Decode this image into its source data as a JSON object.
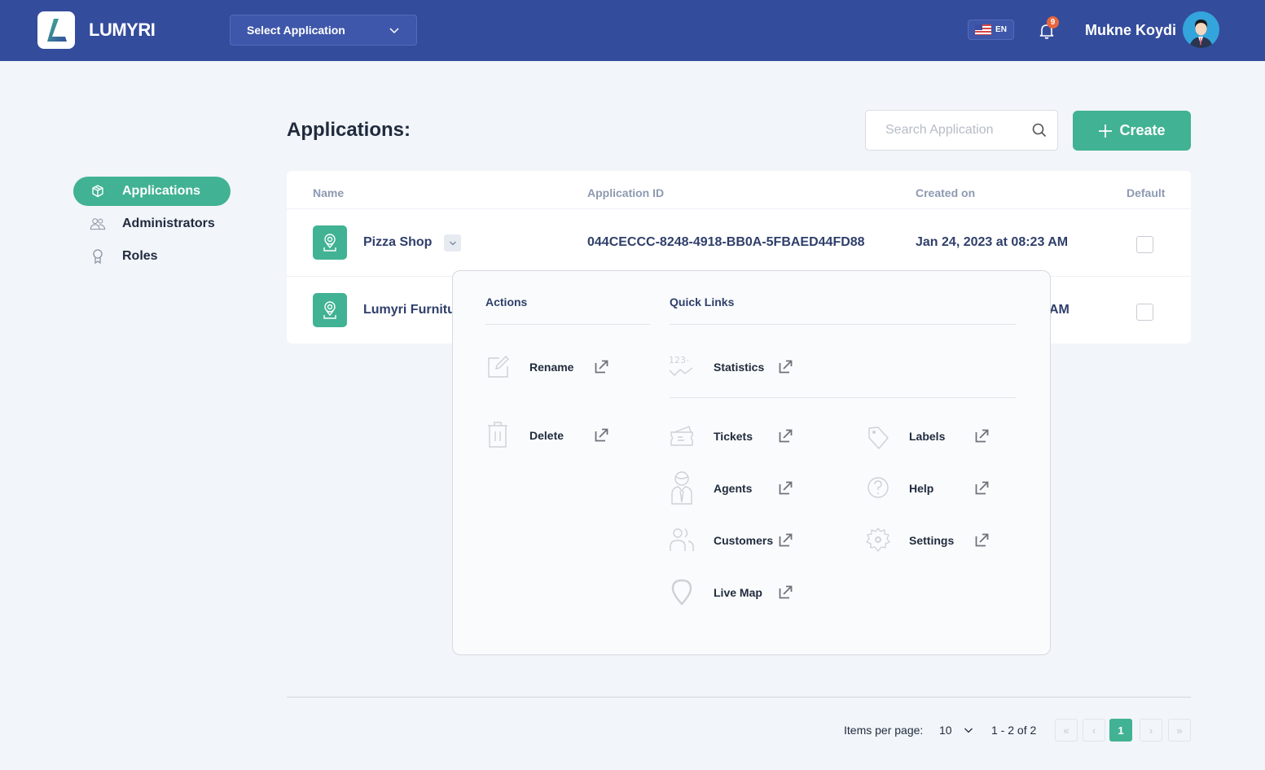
{
  "header": {
    "brand": "LUMYRI",
    "app_select_label": "Select Application",
    "language": "EN",
    "notification_count": "9",
    "user_name": "Mukne Koydi"
  },
  "sidebar": {
    "items": [
      {
        "label": "Applications",
        "icon": "cube-icon",
        "active": true
      },
      {
        "label": "Administrators",
        "icon": "users-icon",
        "active": false
      },
      {
        "label": "Roles",
        "icon": "award-icon",
        "active": false
      }
    ]
  },
  "main": {
    "title": "Applications:",
    "search_placeholder": "Search Application",
    "create_label": "Create"
  },
  "table": {
    "columns": [
      "Name",
      "Application ID",
      "Created on",
      "Default"
    ],
    "rows": [
      {
        "name": "Pizza Shop",
        "id": "044CECCC-8248-4918-BB0A-5FBAED44FD88",
        "created": "Jan 24, 2023 at 08:23 AM",
        "default": false
      },
      {
        "name": "Lumyri Furniture",
        "id": "",
        "created": "AM",
        "default": false
      }
    ]
  },
  "dropdown": {
    "actions_title": "Actions",
    "quick_links_title": "Quick Links",
    "actions": [
      {
        "label": "Rename",
        "icon": "edit-icon"
      },
      {
        "label": "Delete",
        "icon": "trash-icon"
      }
    ],
    "quick_links": [
      {
        "label": "Statistics",
        "icon": "statistics-icon"
      },
      {
        "label": "Tickets",
        "icon": "ticket-icon"
      },
      {
        "label": "Agents",
        "icon": "agent-icon"
      },
      {
        "label": "Customers",
        "icon": "customers-icon"
      },
      {
        "label": "Live Map",
        "icon": "map-pin-icon"
      },
      {
        "label": "Labels",
        "icon": "tag-icon"
      },
      {
        "label": "Help",
        "icon": "help-icon"
      },
      {
        "label": "Settings",
        "icon": "settings-icon"
      }
    ]
  },
  "pagination": {
    "items_per_page_label": "Items per page:",
    "items_per_page": "10",
    "range": "1 - 2 of 2",
    "current_page": "1"
  },
  "colors": {
    "header_bg": "#344c9c",
    "accent": "#41b293",
    "text_dark": "#2f3f6b",
    "badge": "#e8663d"
  }
}
